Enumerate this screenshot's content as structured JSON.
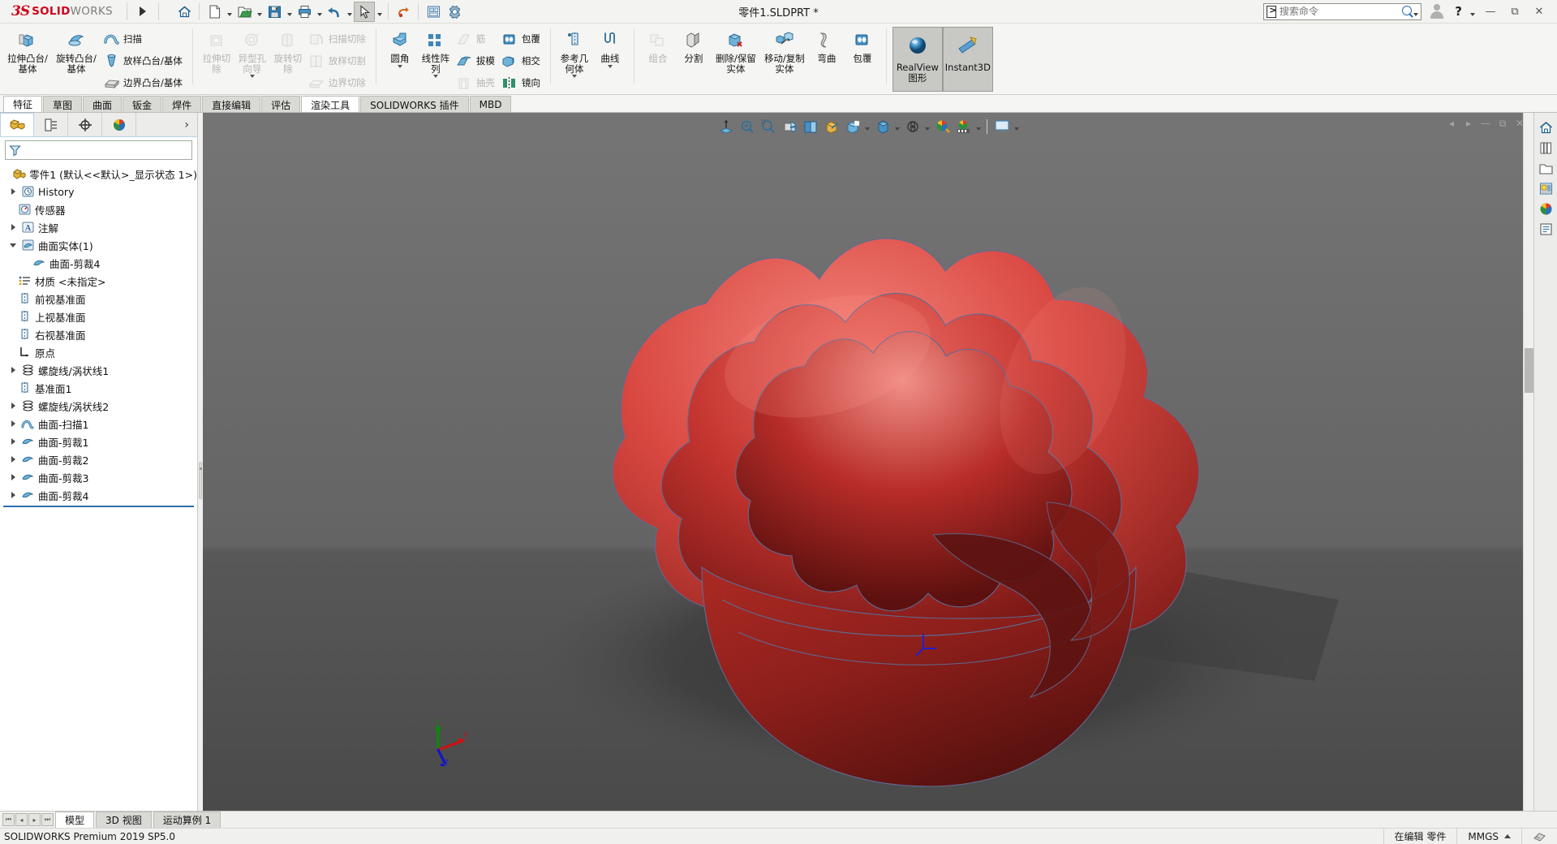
{
  "titlebar": {
    "logo_ds": "3S",
    "logo_solid": "SOLID",
    "logo_works": "WORKS",
    "document_title": "零件1.SLDPRT *",
    "quick_access": [
      {
        "name": "home-icon",
        "label": "主页"
      },
      {
        "name": "new-document-icon",
        "label": "新建"
      },
      {
        "name": "open-folder-icon",
        "label": "打开"
      },
      {
        "name": "save-icon",
        "label": "保存"
      },
      {
        "name": "print-icon",
        "label": "打印"
      },
      {
        "name": "undo-icon",
        "label": "撤销"
      },
      {
        "name": "select-cursor-icon",
        "label": "选择"
      },
      {
        "name": "rebuild-icon",
        "label": "重建模型"
      },
      {
        "name": "drawing-icon",
        "label": "工程图"
      },
      {
        "name": "options-gear-icon",
        "label": "选项"
      }
    ],
    "search": {
      "placeholder": "搜索命令",
      "value": ""
    },
    "help_label": "?",
    "window_buttons": [
      "minimize",
      "restore",
      "close"
    ]
  },
  "ribbon": {
    "groups": [
      {
        "name": "boss-base",
        "big": [
          {
            "label": "拉伸凸台/基体",
            "icon": "extrude-boss-icon",
            "disabled": false,
            "caret": false
          },
          {
            "label": "旋转凸台/基体",
            "icon": "revolve-boss-icon",
            "disabled": false,
            "caret": false
          }
        ],
        "small": [
          {
            "label": "扫描",
            "icon": "sweep-icon",
            "disabled": false
          },
          {
            "label": "放样凸台/基体",
            "icon": "loft-boss-icon",
            "disabled": false
          },
          {
            "label": "边界凸台/基体",
            "icon": "boundary-boss-icon",
            "disabled": false
          }
        ]
      },
      {
        "name": "cut",
        "big": [
          {
            "label": "拉伸切除",
            "icon": "extrude-cut-icon",
            "disabled": true,
            "caret": false
          },
          {
            "label": "异型孔向导",
            "icon": "hole-wizard-icon",
            "disabled": true,
            "caret": true
          },
          {
            "label": "旋转切除",
            "icon": "revolve-cut-icon",
            "disabled": true,
            "caret": false
          }
        ],
        "small": [
          {
            "label": "扫描切除",
            "icon": "swept-cut-icon",
            "disabled": true
          },
          {
            "label": "放样切割",
            "icon": "lofted-cut-icon",
            "disabled": true
          },
          {
            "label": "边界切除",
            "icon": "boundary-cut-icon",
            "disabled": true
          }
        ]
      },
      {
        "name": "features",
        "big": [
          {
            "label": "圆角",
            "icon": "fillet-icon",
            "disabled": false,
            "caret": true
          },
          {
            "label": "线性阵列",
            "icon": "linear-pattern-icon",
            "disabled": false,
            "caret": true
          }
        ],
        "small": [
          {
            "label": "筋",
            "icon": "rib-icon",
            "disabled": true
          },
          {
            "label": "拔模",
            "icon": "draft-icon",
            "disabled": false
          },
          {
            "label": "抽壳",
            "icon": "shell-icon",
            "disabled": true
          }
        ],
        "small2": [
          {
            "label": "包覆",
            "icon": "wrap-icon",
            "disabled": false
          },
          {
            "label": "相交",
            "icon": "intersect-icon",
            "disabled": false
          },
          {
            "label": "镜向",
            "icon": "mirror-icon",
            "disabled": false
          }
        ]
      },
      {
        "name": "reference",
        "big": [
          {
            "label": "参考几何体",
            "icon": "reference-geometry-icon",
            "disabled": false,
            "caret": true
          },
          {
            "label": "曲线",
            "icon": "curves-icon",
            "disabled": false,
            "caret": true
          }
        ]
      },
      {
        "name": "bodies",
        "big": [
          {
            "label": "组合",
            "icon": "combine-icon",
            "disabled": true,
            "caret": false
          },
          {
            "label": "分割",
            "icon": "split-icon",
            "disabled": false,
            "caret": false
          },
          {
            "label": "删除/保留实体",
            "icon": "delete-keep-body-icon",
            "disabled": false,
            "caret": false
          },
          {
            "label": "移动/复制实体",
            "icon": "move-copy-body-icon",
            "disabled": false,
            "caret": false
          },
          {
            "label": "弯曲",
            "icon": "flex-icon",
            "disabled": false,
            "caret": false
          },
          {
            "label": "包覆",
            "icon": "wrap2-icon",
            "disabled": false,
            "caret": false
          }
        ]
      },
      {
        "name": "display",
        "toggles": [
          {
            "label": "RealView 图形",
            "icon": "realview-sphere-icon",
            "active": true
          },
          {
            "label": "Instant3D",
            "icon": "instant3d-icon",
            "active": true
          }
        ]
      }
    ]
  },
  "command_tabs": [
    {
      "label": "特征",
      "state": "active"
    },
    {
      "label": "草图",
      "state": "normal"
    },
    {
      "label": "曲面",
      "state": "normal"
    },
    {
      "label": "钣金",
      "state": "normal"
    },
    {
      "label": "焊件",
      "state": "normal"
    },
    {
      "label": "直接编辑",
      "state": "normal"
    },
    {
      "label": "评估",
      "state": "normal"
    },
    {
      "label": "渲染工具",
      "state": "current"
    },
    {
      "label": "SOLIDWORKS 插件",
      "state": "normal"
    },
    {
      "label": "MBD",
      "state": "normal"
    }
  ],
  "left_panel": {
    "tabs": [
      {
        "name": "feature-manager-tab",
        "icon": "feature-tree-icon",
        "active": true
      },
      {
        "name": "property-manager-tab",
        "icon": "property-manager-icon",
        "active": false
      },
      {
        "name": "configuration-manager-tab",
        "icon": "configuration-icon",
        "active": false
      },
      {
        "name": "display-manager-tab",
        "icon": "display-manager-icon",
        "active": false
      }
    ],
    "expand_arrow": "›",
    "filter_placeholder": "",
    "tree": [
      {
        "label": "零件1  (默认<<默认>_显示状态 1>)",
        "icon": "part-icon",
        "indent": 0,
        "arrow": "none"
      },
      {
        "label": "History",
        "icon": "history-icon",
        "indent": 1,
        "arrow": "collapsed"
      },
      {
        "label": "传感器",
        "icon": "sensor-icon",
        "indent": 1,
        "arrow": "none"
      },
      {
        "label": "注解",
        "icon": "annotation-icon",
        "indent": 1,
        "arrow": "collapsed"
      },
      {
        "label": "曲面实体(1)",
        "icon": "surface-bodies-icon",
        "indent": 1,
        "arrow": "expanded"
      },
      {
        "label": "曲面-剪裁4",
        "icon": "surface-trim-icon",
        "indent": 2,
        "arrow": "none"
      },
      {
        "label": "材质 <未指定>",
        "icon": "material-icon",
        "indent": 1,
        "arrow": "none"
      },
      {
        "label": "前视基准面",
        "icon": "plane-icon",
        "indent": 1,
        "arrow": "none"
      },
      {
        "label": "上视基准面",
        "icon": "plane-icon",
        "indent": 1,
        "arrow": "none"
      },
      {
        "label": "右视基准面",
        "icon": "plane-icon",
        "indent": 1,
        "arrow": "none"
      },
      {
        "label": "原点",
        "icon": "origin-icon",
        "indent": 1,
        "arrow": "none"
      },
      {
        "label": "螺旋线/涡状线1",
        "icon": "helix-icon",
        "indent": 1,
        "arrow": "collapsed"
      },
      {
        "label": "基准面1",
        "icon": "plane-icon",
        "indent": 1,
        "arrow": "none"
      },
      {
        "label": "螺旋线/涡状线2",
        "icon": "helix-icon",
        "indent": 1,
        "arrow": "collapsed"
      },
      {
        "label": "曲面-扫描1",
        "icon": "surface-sweep-icon",
        "indent": 1,
        "arrow": "collapsed"
      },
      {
        "label": "曲面-剪裁1",
        "icon": "surface-trim-icon",
        "indent": 1,
        "arrow": "collapsed"
      },
      {
        "label": "曲面-剪裁2",
        "icon": "surface-trim-icon",
        "indent": 1,
        "arrow": "collapsed"
      },
      {
        "label": "曲面-剪裁3",
        "icon": "surface-trim-icon",
        "indent": 1,
        "arrow": "collapsed"
      },
      {
        "label": "曲面-剪裁4",
        "icon": "surface-trim-icon",
        "indent": 1,
        "arrow": "collapsed"
      }
    ]
  },
  "view_toolbar": [
    {
      "name": "zoom-to-fit-icon",
      "caret": false
    },
    {
      "name": "zoom-to-area-icon",
      "caret": false
    },
    {
      "name": "previous-view-icon",
      "caret": false
    },
    {
      "name": "section-view-icon",
      "caret": false
    },
    {
      "name": "view-orientation-icon",
      "caret": false
    },
    {
      "name": "display-style-icon",
      "caret": true
    },
    {
      "name": "hide-show-items-icon",
      "caret": true
    },
    {
      "name": "edit-appearance-icon",
      "caret": false
    },
    {
      "name": "apply-scene-icon",
      "caret": true
    },
    {
      "name": "view-settings-icon",
      "caret": true
    }
  ],
  "graphics": {
    "background_top": "#6e6e6e",
    "background_bottom": "#4a4a4a",
    "model_color": "#c0332f",
    "model_highlight": "#f06a60",
    "triad": {
      "x_label": "X",
      "y_label": "Y",
      "z_label": "Z",
      "x_color": "#cc0000",
      "y_color": "#007a00",
      "z_color": "#0033cc"
    }
  },
  "task_pane": [
    {
      "name": "home-panel-icon"
    },
    {
      "name": "design-library-icon"
    },
    {
      "name": "file-explorer-icon"
    },
    {
      "name": "view-palette-icon"
    },
    {
      "name": "appearances-scenes-icon"
    },
    {
      "name": "custom-properties-icon"
    }
  ],
  "bottom": {
    "nav_buttons": [
      "first",
      "previous",
      "next",
      "last"
    ],
    "tabs": [
      {
        "label": "模型",
        "active": true
      },
      {
        "label": "3D 视图",
        "active": false
      },
      {
        "label": "运动算例 1",
        "active": false
      }
    ]
  },
  "statusbar": {
    "product": "SOLIDWORKS Premium 2019 SP5.0",
    "edit_state": "在编辑 零件",
    "units": "MMGS"
  }
}
